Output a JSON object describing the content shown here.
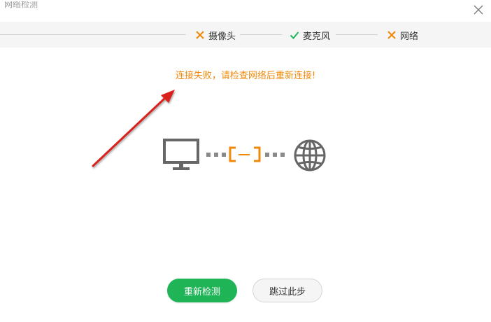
{
  "window": {
    "title": "网络检测",
    "close_icon": "close-icon"
  },
  "steps": [
    {
      "label": "摄像头",
      "status": "fail",
      "icon": "x-icon",
      "color": "#f0890a"
    },
    {
      "label": "麦克风",
      "status": "pass",
      "icon": "check-icon",
      "color": "#1fb556"
    },
    {
      "label": "网络",
      "status": "fail",
      "icon": "x-icon",
      "color": "#f0890a"
    }
  ],
  "message": {
    "text": "连接失败，请检查网络后重新连接!",
    "color": "#f0890a"
  },
  "diagram": {
    "left_icon": "monitor-icon",
    "middle_icon": "broken-link-icon",
    "right_icon": "globe-icon",
    "icon_color": "#666666",
    "link_color": "#f0890a"
  },
  "buttons": {
    "retry_label": "重新检测",
    "skip_label": "跳过此步",
    "retry_color": "#1fb556"
  },
  "annotation": {
    "icon": "red-arrow",
    "color": "#d9221c"
  }
}
